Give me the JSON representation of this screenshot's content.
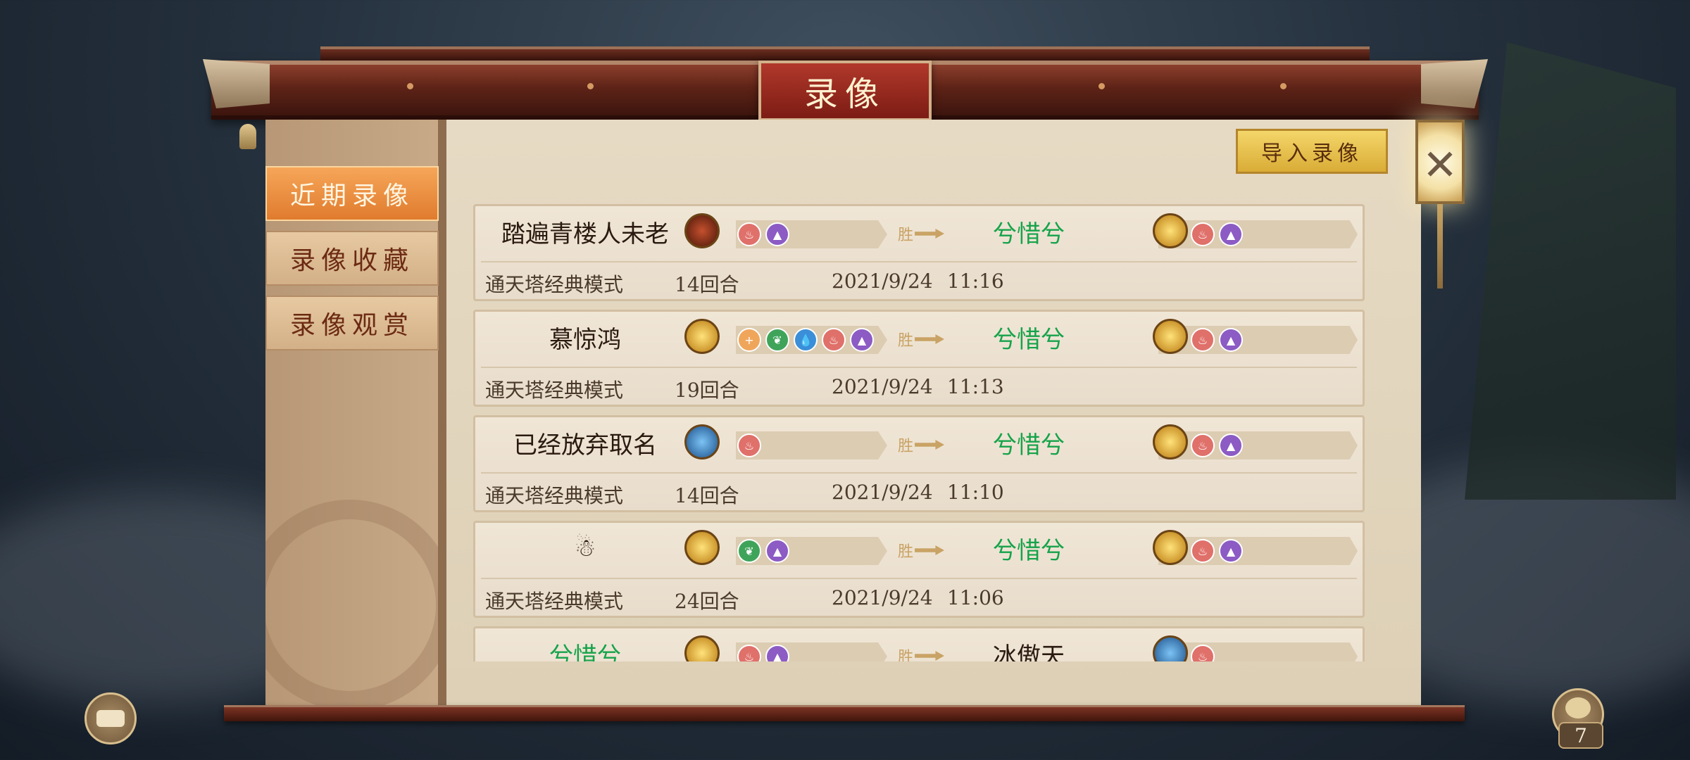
{
  "title": "录像",
  "tabs": [
    {
      "label": "近期录像",
      "active": true
    },
    {
      "label": "录像收藏",
      "active": false
    },
    {
      "label": "录像观赏",
      "active": false
    }
  ],
  "import_button": "导入录像",
  "win_mark": "胜",
  "records": [
    {
      "player1": "踏遍青楼人未老",
      "player1_avatar": "dark-red-hero-icon",
      "player1_elements": [
        "fire",
        "lightning"
      ],
      "player2": "兮惜兮",
      "player2_avatar": "gold-hero-icon",
      "player2_elements": [
        "fire",
        "lightning"
      ],
      "mode": "通天塔经典模式",
      "rounds": "14回合",
      "date": "2021/9/24",
      "time": "11:16"
    },
    {
      "player1": "慕惊鸿",
      "player1_avatar": "gold-hero-icon",
      "player1_elements": [
        "gold",
        "wood",
        "water",
        "fire",
        "lightning"
      ],
      "player2": "兮惜兮",
      "player2_avatar": "gold-hero-icon",
      "player2_elements": [
        "fire",
        "lightning"
      ],
      "mode": "通天塔经典模式",
      "rounds": "19回合",
      "date": "2021/9/24",
      "time": "11:13"
    },
    {
      "player1": "已经放弃取名",
      "player1_avatar": "blue-hero-icon",
      "player1_elements": [
        "fire"
      ],
      "player2": "兮惜兮",
      "player2_avatar": "gold-hero-icon",
      "player2_elements": [
        "fire",
        "lightning"
      ],
      "mode": "通天塔经典模式",
      "rounds": "14回合",
      "date": "2021/9/24",
      "time": "11:10"
    },
    {
      "player1": "☃",
      "player1_avatar": "gold-hero-icon",
      "player1_elements": [
        "wood",
        "lightning"
      ],
      "player2": "兮惜兮",
      "player2_avatar": "gold-hero-icon",
      "player2_elements": [
        "fire",
        "lightning"
      ],
      "mode": "通天塔经典模式",
      "rounds": "24回合",
      "date": "2021/9/24",
      "time": "11:06"
    },
    {
      "player1": "兮惜兮",
      "player1_avatar": "gold-hero-icon",
      "player1_elements": [
        "fire",
        "lightning"
      ],
      "player2": "冰傲天",
      "player2_avatar": "blue-hero-icon",
      "player2_elements": [
        "fire"
      ],
      "mode": "",
      "rounds": "",
      "date": "",
      "time": ""
    }
  ],
  "bag_count": "7",
  "colors": {
    "fire": "#e0706a",
    "lightning": "#8c5bc4",
    "wood": "#3fa45a",
    "water": "#3a8fd8",
    "gold": "#f0a65a",
    "winner_name": "#15a34a",
    "tab_active": "#f0933f"
  }
}
